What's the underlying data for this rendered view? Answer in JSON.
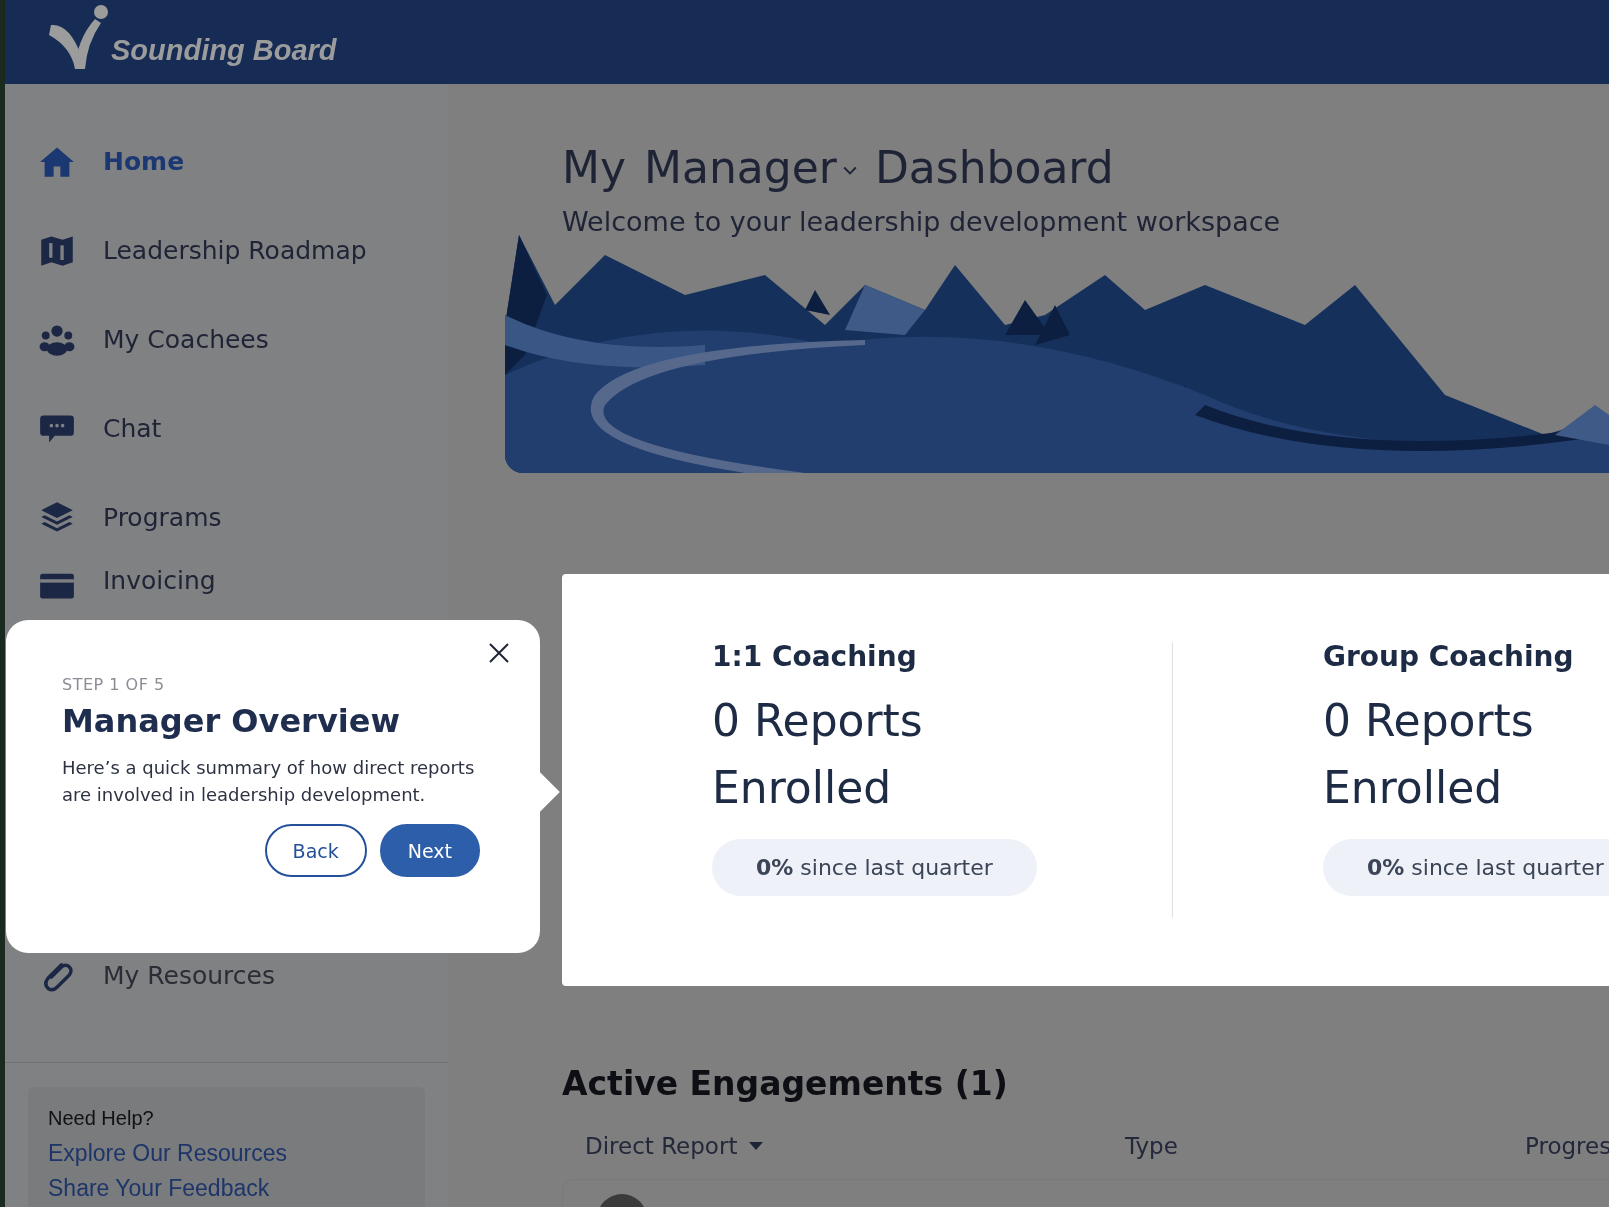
{
  "header": {
    "logo_text": "Sounding Board"
  },
  "sidebar": {
    "items": [
      {
        "label": "Home",
        "selected": true
      },
      {
        "label": "Leadership Roadmap",
        "selected": false
      },
      {
        "label": "My Coachees",
        "selected": false
      },
      {
        "label": "Chat",
        "selected": false
      },
      {
        "label": "Programs",
        "selected": false
      },
      {
        "label": "Invoicing",
        "selected": false
      },
      {
        "label": "My Resources",
        "selected": false
      }
    ],
    "help": {
      "title": "Need Help?",
      "links": [
        "Explore Our Resources",
        "Share Your Feedback"
      ]
    }
  },
  "title": {
    "prefix": "My",
    "role": "Manager",
    "suffix": "Dashboard"
  },
  "subtitle": "Welcome to your leadership development workspace",
  "stats": [
    {
      "title": "1:1 Coaching",
      "value": "0 Reports Enrolled",
      "change": "**0%** since last quarter"
    },
    {
      "title": "Group Coaching",
      "value": "0 Reports Enrolled",
      "change": "**0%** since last quarter"
    }
  ],
  "engagements": {
    "title": "Active Engagements (1)",
    "columns": [
      {
        "label": "Direct Report",
        "sorted": true
      },
      {
        "label": "Type"
      },
      {
        "label": "Progres"
      }
    ]
  },
  "tour": {
    "step": "STEP 1 OF 5",
    "title": "Manager Overview",
    "body": "Here’s a quick summary of how direct reports are involved in leadership development.",
    "buttons": [
      "Back",
      "Next"
    ]
  }
}
